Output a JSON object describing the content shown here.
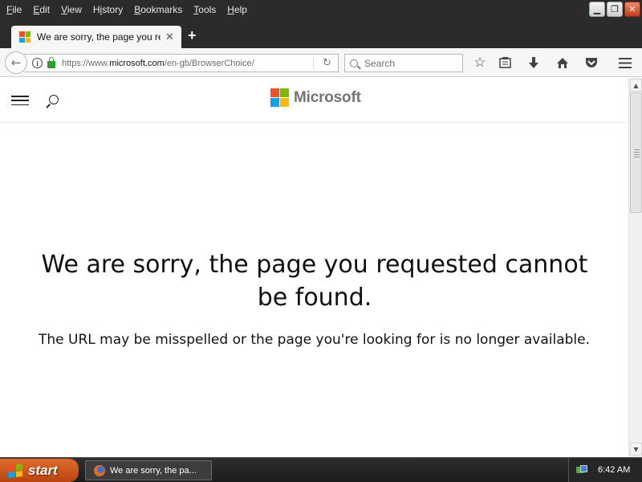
{
  "menubar": {
    "items": [
      {
        "key": "F",
        "rest": "ile"
      },
      {
        "key": "E",
        "rest": "dit"
      },
      {
        "key": "V",
        "rest": "iew"
      },
      {
        "key": "",
        "rest": "History",
        "underline_index": 1
      },
      {
        "key": "B",
        "rest": "ookmarks"
      },
      {
        "key": "T",
        "rest": "ools"
      },
      {
        "key": "H",
        "rest": "elp"
      }
    ]
  },
  "tab": {
    "title": "We are sorry, the page you req...",
    "close_glyph": "✕",
    "new_tab_glyph": "+"
  },
  "navbar": {
    "url_prefix": "https://www.",
    "url_host": "microsoft.com",
    "url_path": "/en-gb/BrowserChoice/",
    "search_placeholder": "Search"
  },
  "site": {
    "brand": "Microsoft",
    "logo_colors": [
      "#f25022",
      "#7fba00",
      "#00a4ef",
      "#ffb900"
    ]
  },
  "error": {
    "title": "We are sorry, the page you requested cannot be found.",
    "subtitle": "The URL may be misspelled or the page you're looking for is no longer available."
  },
  "taskbar": {
    "start_label": "start",
    "task_label": "We are sorry, the pa...",
    "clock": "6:42 AM"
  }
}
